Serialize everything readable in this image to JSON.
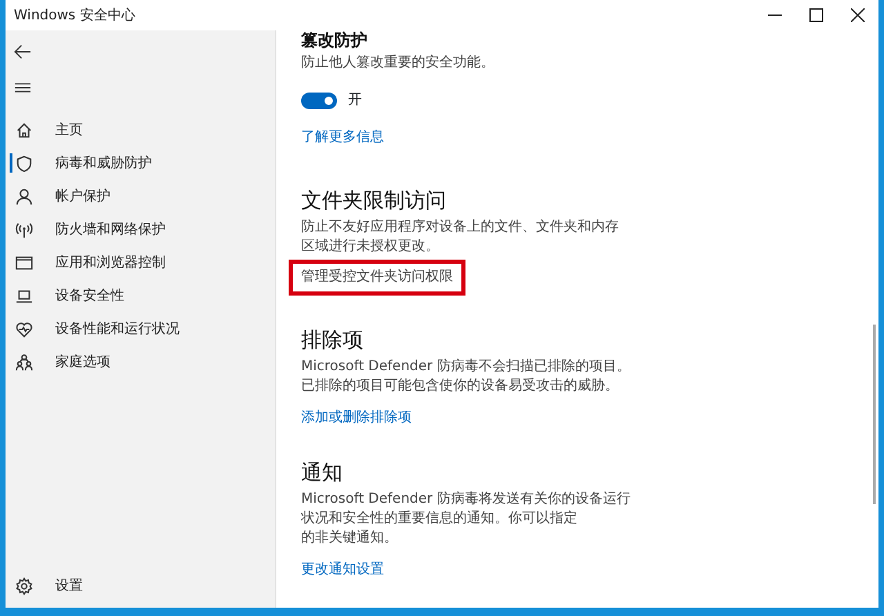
{
  "window": {
    "title": "Windows 安全中心"
  },
  "sidebar": {
    "items": [
      {
        "label": "主页",
        "selected": false
      },
      {
        "label": "病毒和威胁防护",
        "selected": true
      },
      {
        "label": "帐户保护",
        "selected": false
      },
      {
        "label": "防火墙和网络保护",
        "selected": false
      },
      {
        "label": "应用和浏览器控制",
        "selected": false
      },
      {
        "label": "设备安全性",
        "selected": false
      },
      {
        "label": "设备性能和运行状况",
        "selected": false
      },
      {
        "label": "家庭选项",
        "selected": false
      }
    ],
    "settings": {
      "label": "设置"
    }
  },
  "sections": [
    {
      "kind": "minor",
      "title": "篡改防护",
      "description": [
        "防止他人篡改重要的安全功能。"
      ],
      "toggle": {
        "on": true,
        "label": "开"
      },
      "link": {
        "label": "了解更多信息",
        "highlighted": false
      }
    },
    {
      "kind": "major",
      "title": "文件夹限制访问",
      "description": [
        "防止不友好应用程序对设备上的文件、文件夹和内存",
        "区域进行未授权更改。"
      ],
      "link": {
        "label": "管理受控文件夹访问权限",
        "highlighted": true
      }
    },
    {
      "kind": "major",
      "title": "排除项",
      "description": [
        "Microsoft Defender 防病毒不会扫描已排除的项目。",
        "已排除的项目可能包含使你的设备易受攻击的威胁。"
      ],
      "link": {
        "label": "添加或删除排除项",
        "highlighted": false
      }
    },
    {
      "kind": "major",
      "title": "通知",
      "description": [
        "Microsoft Defender 防病毒将发送有关你的设备运行",
        "状况和安全性的重要信息的通知。你可以指定",
        "的非关键通知。"
      ],
      "link": {
        "label": "更改通知设置",
        "highlighted": false
      }
    }
  ]
}
